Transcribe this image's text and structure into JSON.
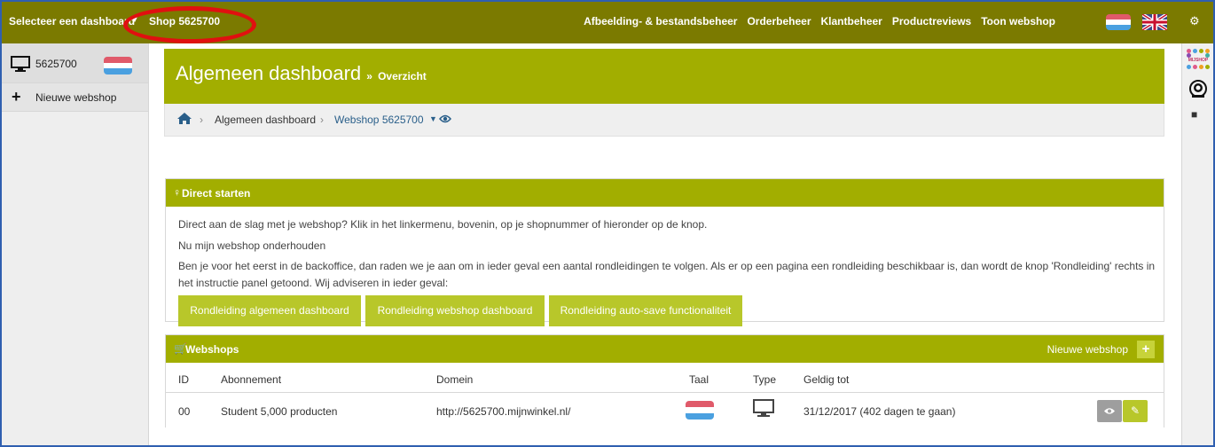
{
  "topbar": {
    "select_dashboard": "Selecteer een dashboard",
    "shop": "Shop 5625700",
    "nav": [
      "Afbeelding- & bestandsbeheer",
      "Orderbeheer",
      "Klantbeheer",
      "Productreviews",
      "Toon webshop"
    ]
  },
  "sidebar": {
    "shop_id": "5625700",
    "new_webshop": "Nieuwe webshop"
  },
  "rsidebar": {
    "logo_text": "MIJSHOP"
  },
  "header": {
    "title": "Algemeen dashboard",
    "separator": "»",
    "subtitle": "Overzicht"
  },
  "breadcrumb": {
    "item1": "Algemeen dashboard",
    "item2": "Webshop 5625700"
  },
  "start_panel": {
    "title": "Direct starten",
    "line1": "Direct aan de slag met je webshop? Klik in het linkermenu, bovenin, op je shopnummer of hieronder op de knop.",
    "line2": "Nu mijn webshop onderhouden",
    "line3": "Ben je voor het eerst in de backoffice, dan raden we je aan om in ieder geval een aantal rondleidingen te volgen. Als er op een pagina een rondleiding beschikbaar is, dan wordt de knop 'Rondleiding' rechts in",
    "line4": "het instructie panel getoond. Wij adviseren in ieder geval:",
    "buttons": [
      "Rondleiding algemeen dashboard",
      "Rondleiding webshop dashboard",
      "Rondleiding auto-save functionaliteit"
    ]
  },
  "webshops_panel": {
    "title": "Webshops",
    "new_label": "Nieuwe webshop",
    "columns": [
      "ID",
      "Abonnement",
      "Domein",
      "Taal",
      "Type",
      "Geldig tot"
    ],
    "rows": [
      {
        "id": "00",
        "abonnement": "Student  5,000  producten",
        "domein": "http://5625700.mijnwinkel.nl/",
        "geldig_tot": "31/12/2017 (402 dagen te gaan)"
      }
    ]
  },
  "colors": {
    "topbar": "#7b7a00",
    "accent": "#a2ae00",
    "button": "#b8c72a",
    "annotation": "#e01010"
  }
}
